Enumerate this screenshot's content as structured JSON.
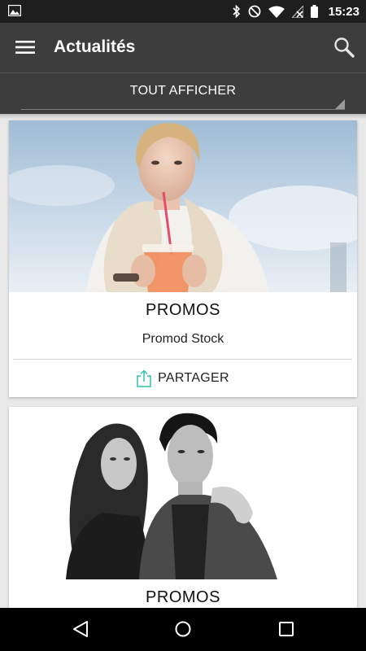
{
  "status_bar": {
    "time": "15:23",
    "icons": [
      "image-notification-icon",
      "bluetooth-icon",
      "do-not-disturb-icon",
      "wifi-icon",
      "no-signal-icon",
      "battery-icon"
    ]
  },
  "app_bar": {
    "title": "Actualités",
    "menu_icon": "hamburger-menu-icon",
    "search_icon": "search-icon"
  },
  "filter": {
    "selected": "TOUT AFFICHER"
  },
  "feed": {
    "cards": [
      {
        "category": "PROMOS",
        "brand": "Promod Stock",
        "share_label": "PARTAGER",
        "image": "woman-drinking-iced-drink-photo"
      },
      {
        "category": "PROMOS",
        "image": "couple-black-and-white-photo"
      }
    ]
  },
  "colors": {
    "app_bar": "#3d3d3d",
    "status_bar": "#1e1e1e",
    "accent_share": "#2ec4a6",
    "background": "#e8e8e8"
  },
  "nav_bar": {
    "icons": [
      "back-icon",
      "home-icon",
      "recent-apps-icon"
    ]
  }
}
